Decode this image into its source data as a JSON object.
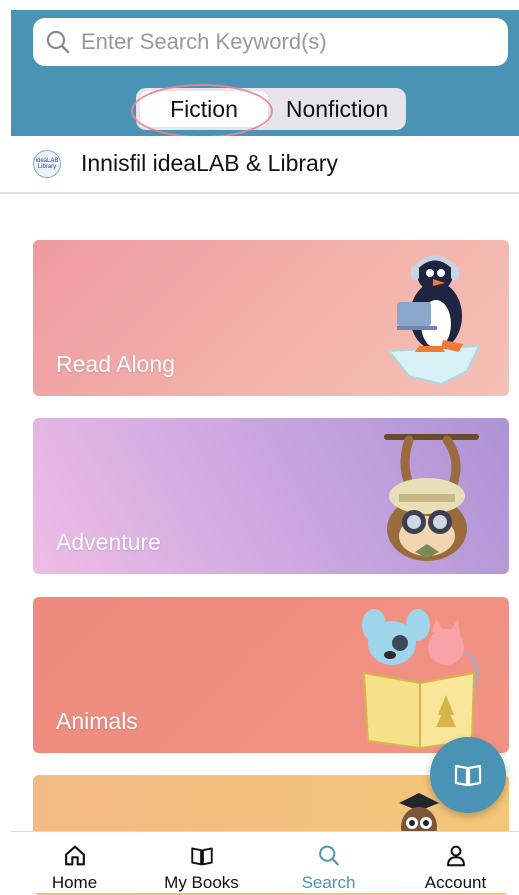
{
  "search": {
    "placeholder": "Enter Search Keyword(s)"
  },
  "segments": {
    "fiction": "Fiction",
    "nonfiction": "Nonfiction",
    "selected": "fiction"
  },
  "library": {
    "name": "Innisfil ideaLAB & Library",
    "logo_text": "ideaLAB Library"
  },
  "categories": [
    {
      "label": "Read Along",
      "art": "penguin-laptop-icon"
    },
    {
      "label": "Adventure",
      "art": "monkey-explorer-icon"
    },
    {
      "label": "Animals",
      "art": "dog-cat-book-icon"
    },
    {
      "label": "",
      "art": "owl-graduate-icon"
    }
  ],
  "fab": {
    "icon": "open-book-icon"
  },
  "tabs": [
    {
      "label": "Home",
      "icon": "home-icon"
    },
    {
      "label": "My Books",
      "icon": "book-icon"
    },
    {
      "label": "Search",
      "icon": "search-icon",
      "active": true
    },
    {
      "label": "Account",
      "icon": "account-icon"
    }
  ],
  "colors": {
    "brand": "#4a93b4",
    "read_along": "#f0a6a6",
    "adventure": "#c4a2de",
    "animals": "#ef8c80",
    "owl_card": "#f3c27f"
  }
}
